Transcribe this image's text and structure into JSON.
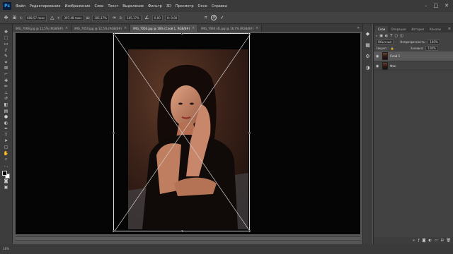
{
  "app": {
    "logo": "Ps"
  },
  "menubar": {
    "items": [
      "Файл",
      "Редактирование",
      "Изображение",
      "Слои",
      "Текст",
      "Выделение",
      "Фильтр",
      "3D",
      "Просмотр",
      "Окно",
      "Справка"
    ],
    "window_buttons": [
      "–",
      "□",
      "✕"
    ]
  },
  "optionsbar": {
    "x_label": "X:",
    "x_value": "608,57 пикс",
    "y_label": "Y:",
    "y_value": "397,48 пикс",
    "w_label": "Ш:",
    "w_value": "105,17%",
    "h_label": "В:",
    "h_value": "105,17%",
    "angle_value": "0,00",
    "interp_value": "Н: 0,00"
  },
  "tabs": [
    {
      "label": "IMG_7069.jpg @ 12,5% (RGB/8#)",
      "active": false
    },
    {
      "label": "IMG_7050.jpg @ 12,5% (RGB/8#)",
      "active": false
    },
    {
      "label": "IMG_7056.jpg @ 16% (Слой 1, RGB/8#)",
      "active": true
    },
    {
      "label": "IMG_7090 (4).jpg @ 16,7% (RGB/8#)",
      "active": false
    }
  ],
  "tabs_more": "»",
  "layers_panel": {
    "tabs": [
      "Слои",
      "Операции",
      "История",
      "Каналы"
    ],
    "filter_label": "Обычные",
    "opacity_label": "Непрозрачность:",
    "opacity_value": "100%",
    "lock_label": "Закреп.:",
    "fill_label": "Заливка:",
    "fill_value": "100%",
    "layers": [
      {
        "name": "Слой 1",
        "active": true
      },
      {
        "name": "Фон",
        "active": false
      }
    ]
  },
  "status": {
    "zoom": "16%"
  },
  "colors": {
    "accent": "#31a8ff",
    "canvas": "#050505",
    "workspace": "#555555"
  }
}
